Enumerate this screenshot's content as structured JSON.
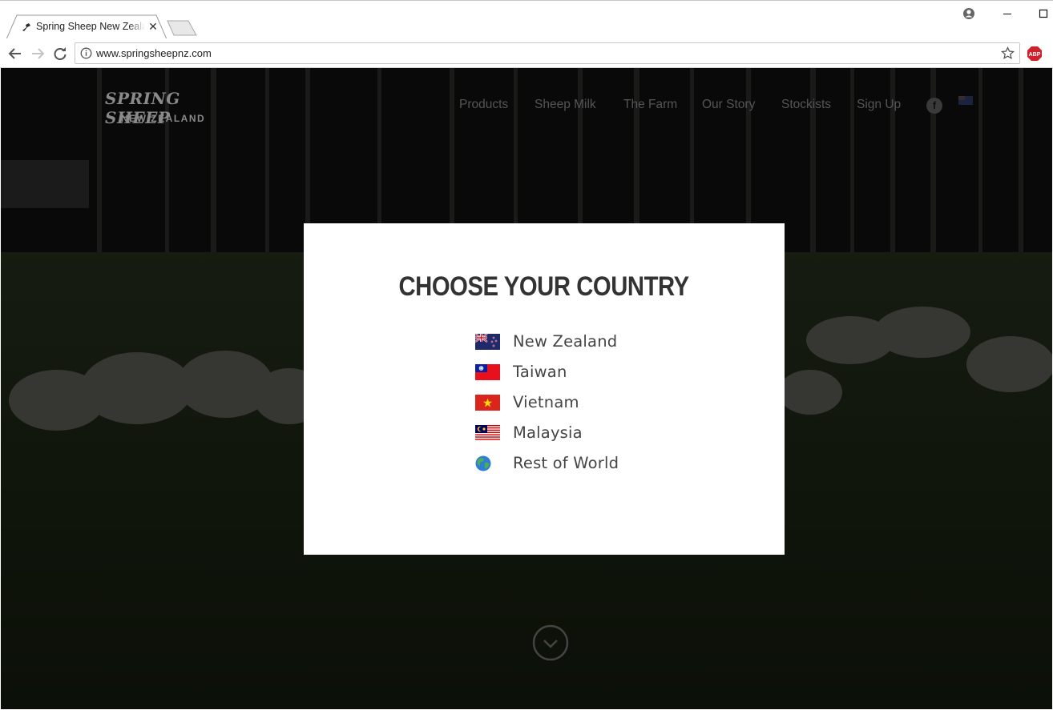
{
  "browser": {
    "tab_title": "Spring Sheep New Zealand",
    "url": "www.springsheepnz.com",
    "extension_label": "ABP"
  },
  "site": {
    "logo_line1": "SPRING SHEEP",
    "logo_line2": "NEW ZEALAND",
    "nav": [
      "Products",
      "Sheep Milk",
      "The Farm",
      "Our Story",
      "Stockists",
      "Sign Up"
    ],
    "facebook_glyph": "f"
  },
  "modal": {
    "title": "CHOOSE YOUR COUNTRY",
    "countries": [
      {
        "label": "New Zealand",
        "flag": "nz-flag-icon"
      },
      {
        "label": "Taiwan",
        "flag": "taiwan-flag-icon"
      },
      {
        "label": "Vietnam",
        "flag": "vietnam-flag-icon"
      },
      {
        "label": "Malaysia",
        "flag": "malaysia-flag-icon"
      },
      {
        "label": "Rest of World",
        "flag": "globe-icon"
      }
    ]
  },
  "colors": {
    "modal_bg": "#ffffff",
    "title": "#333333",
    "country_text": "#444444",
    "overlay": "#000000"
  }
}
